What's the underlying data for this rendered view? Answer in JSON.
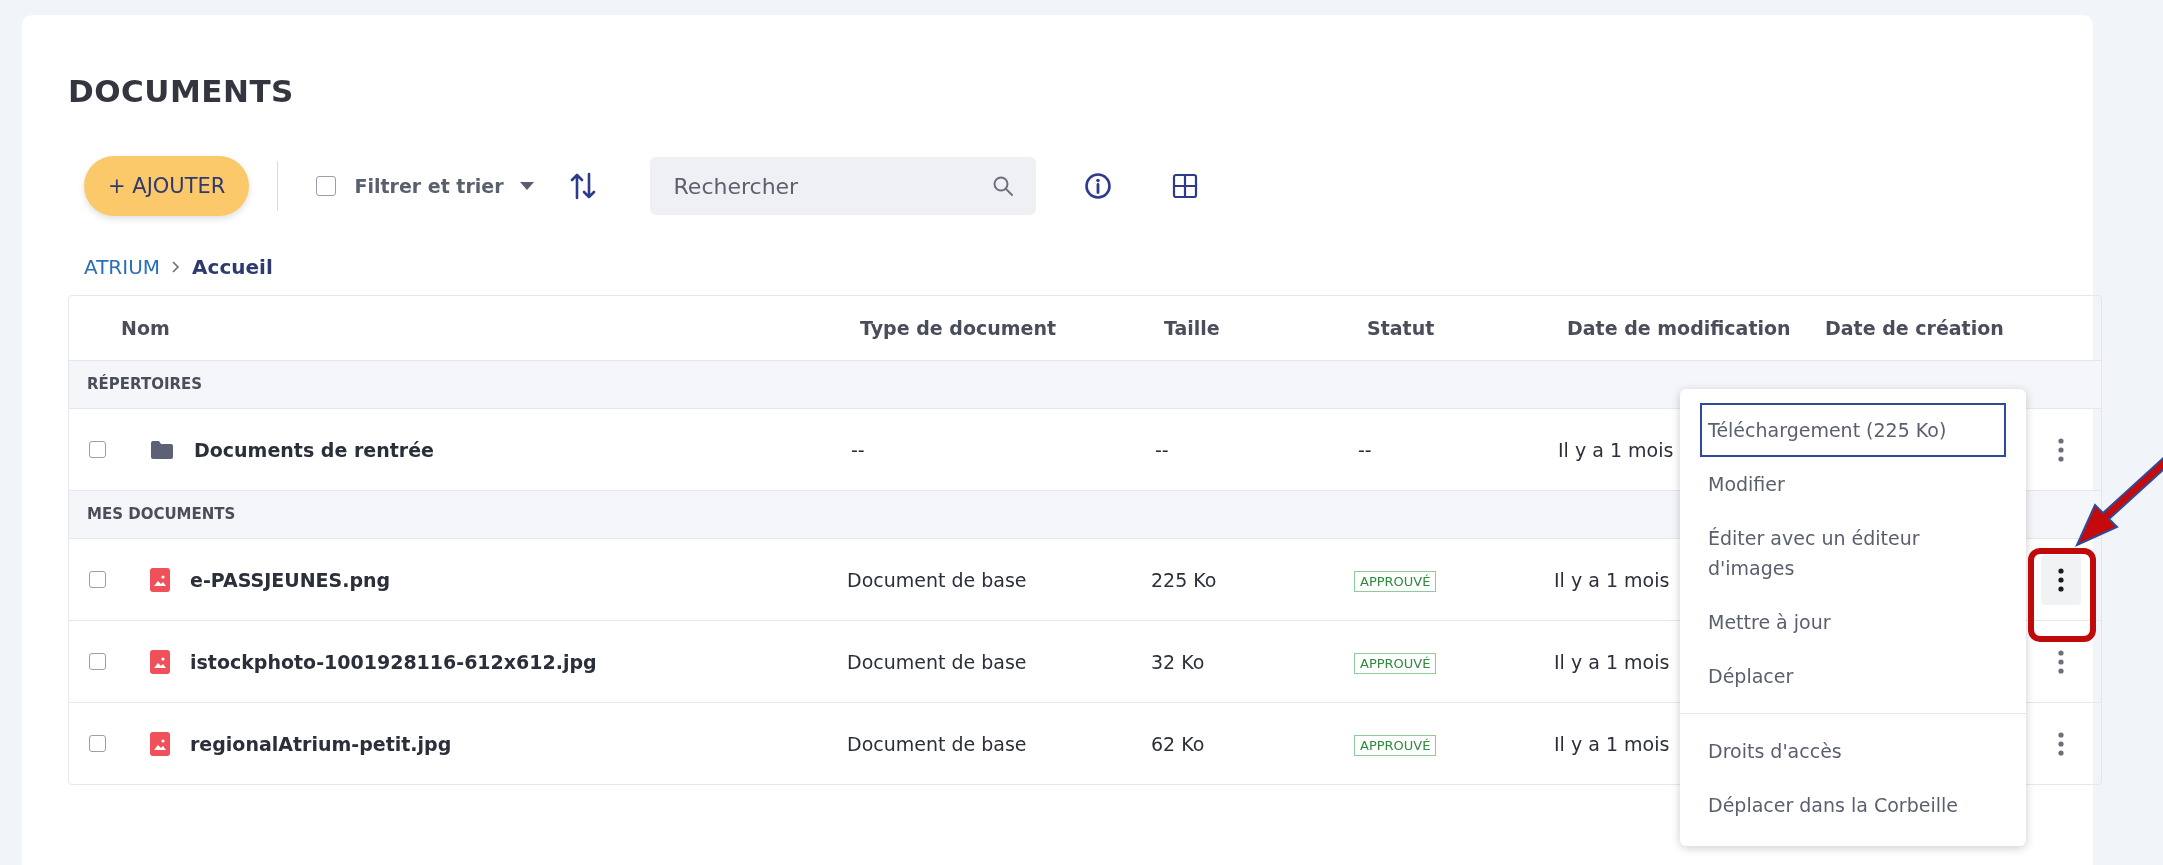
{
  "title": "DOCUMENTS",
  "toolbar": {
    "add_button": "+ AJOUTER",
    "select_all_checked": false,
    "filter": "Filtrer et trier",
    "search": {
      "placeholder": "Rechercher"
    }
  },
  "breadcrumb": [
    {
      "label": "ATRIUM",
      "current": false
    },
    {
      "label": "Accueil",
      "current": true
    }
  ],
  "table": {
    "columns": [
      "Nom",
      "Type de document",
      "Taille",
      "Statut",
      "Date de modification",
      "Date de création"
    ],
    "sections": [
      {
        "label": "RÉPERTOIRES",
        "rows": [
          {
            "kind": "folder",
            "checked": false,
            "name": "Documents de rentrée",
            "type": "--",
            "size": "--",
            "status": "--",
            "modified": "Il y a 1 mois",
            "menu_active": false
          }
        ]
      },
      {
        "label": "MES DOCUMENTS",
        "rows": [
          {
            "kind": "image",
            "checked": false,
            "name": "e-PASSJEUNES.png",
            "type": "Document de base",
            "size": "225 Ko",
            "status": "APPROUVÉ",
            "modified": "Il y a 1 mois",
            "menu_active": true
          },
          {
            "kind": "image",
            "checked": false,
            "name": "istockphoto-1001928116-612x612.jpg",
            "type": "Document de base",
            "size": "32 Ko",
            "status": "APPROUVÉ",
            "modified": "Il y a 1 mois",
            "menu_active": false
          },
          {
            "kind": "image",
            "checked": false,
            "name": "regionalAtrium-petit.jpg",
            "type": "Document de base",
            "size": "62 Ko",
            "status": "APPROUVÉ",
            "modified": "Il y a 1 mois",
            "menu_active": false
          }
        ]
      }
    ]
  },
  "context_menu": {
    "groups": [
      [
        {
          "label": "Téléchargement (225 Ko)",
          "focused": true
        },
        {
          "label": "Modifier",
          "focused": false
        },
        {
          "label": "Éditer avec un éditeur d'images",
          "focused": false
        },
        {
          "label": "Mettre à jour",
          "focused": false
        },
        {
          "label": "Déplacer",
          "focused": false
        }
      ],
      [
        {
          "label": "Droits d'accès",
          "focused": false
        },
        {
          "label": "Déplacer dans la Corbeille",
          "focused": false
        }
      ]
    ]
  }
}
